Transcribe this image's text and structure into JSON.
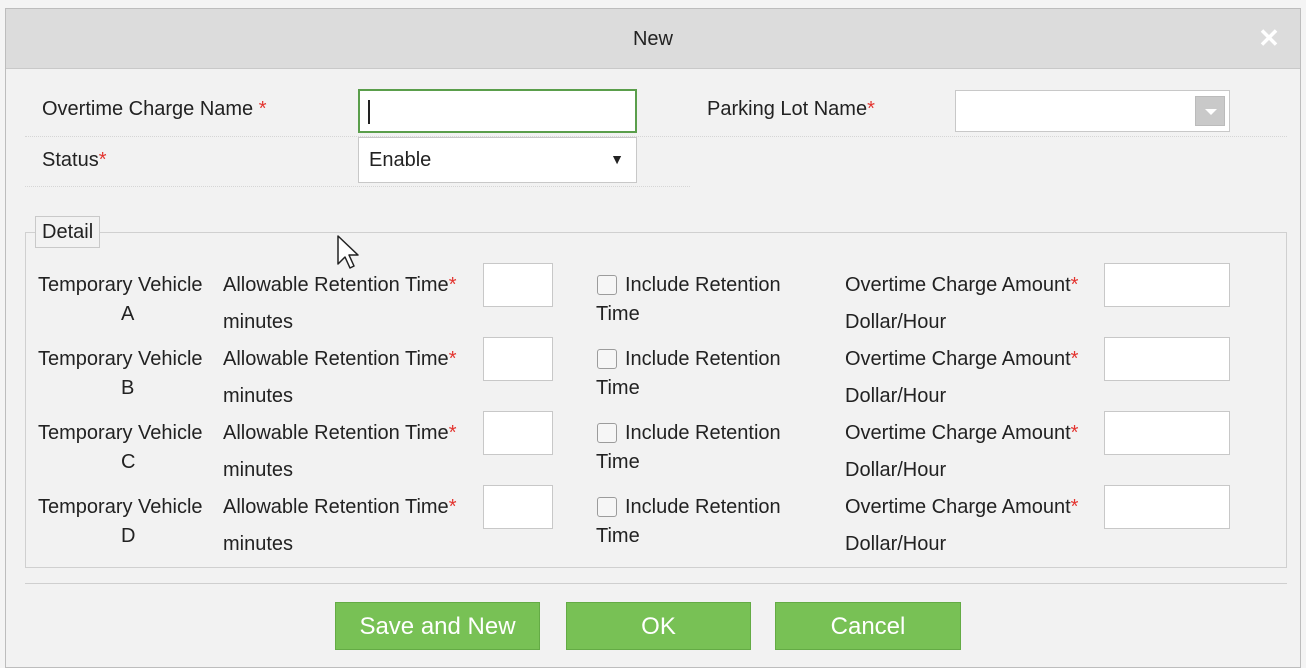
{
  "dialog": {
    "title": "New"
  },
  "form": {
    "overtime_charge_name_label": "Overtime Charge Name",
    "overtime_charge_name_value": "",
    "parking_lot_name_label": "Parking Lot Name",
    "parking_lot_name_value": "",
    "status_label": "Status",
    "status_value": "Enable",
    "required_mark": "*"
  },
  "detail": {
    "legend": "Detail",
    "rows": [
      {
        "name_line1": "Temporary Vehicle",
        "name_line2": "A",
        "retention_label": "Allowable Retention Time",
        "retention_unit": "minutes",
        "retention_value": "",
        "include_label_line1": "Include Retention",
        "include_label_line2": "Time",
        "include_checked": false,
        "amount_label": "Overtime Charge Amount",
        "amount_unit": "Dollar/Hour",
        "amount_value": ""
      },
      {
        "name_line1": "Temporary Vehicle",
        "name_line2": "B",
        "retention_label": "Allowable Retention Time",
        "retention_unit": "minutes",
        "retention_value": "",
        "include_label_line1": "Include Retention",
        "include_label_line2": "Time",
        "include_checked": false,
        "amount_label": "Overtime Charge Amount",
        "amount_unit": "Dollar/Hour",
        "amount_value": ""
      },
      {
        "name_line1": "Temporary Vehicle",
        "name_line2": "C",
        "retention_label": "Allowable Retention Time",
        "retention_unit": "minutes",
        "retention_value": "",
        "include_label_line1": "Include Retention",
        "include_label_line2": "Time",
        "include_checked": false,
        "amount_label": "Overtime Charge Amount",
        "amount_unit": "Dollar/Hour",
        "amount_value": ""
      },
      {
        "name_line1": "Temporary Vehicle",
        "name_line2": "D",
        "retention_label": "Allowable Retention Time",
        "retention_unit": "minutes",
        "retention_value": "",
        "include_label_line1": "Include Retention",
        "include_label_line2": "Time",
        "include_checked": false,
        "amount_label": "Overtime Charge Amount",
        "amount_unit": "Dollar/Hour",
        "amount_value": ""
      }
    ]
  },
  "buttons": {
    "save_and_new": "Save and New",
    "ok": "OK",
    "cancel": "Cancel"
  },
  "colors": {
    "button_green": "#78c155",
    "required_red": "#e3342f",
    "focus_border": "#5a9e4b"
  }
}
